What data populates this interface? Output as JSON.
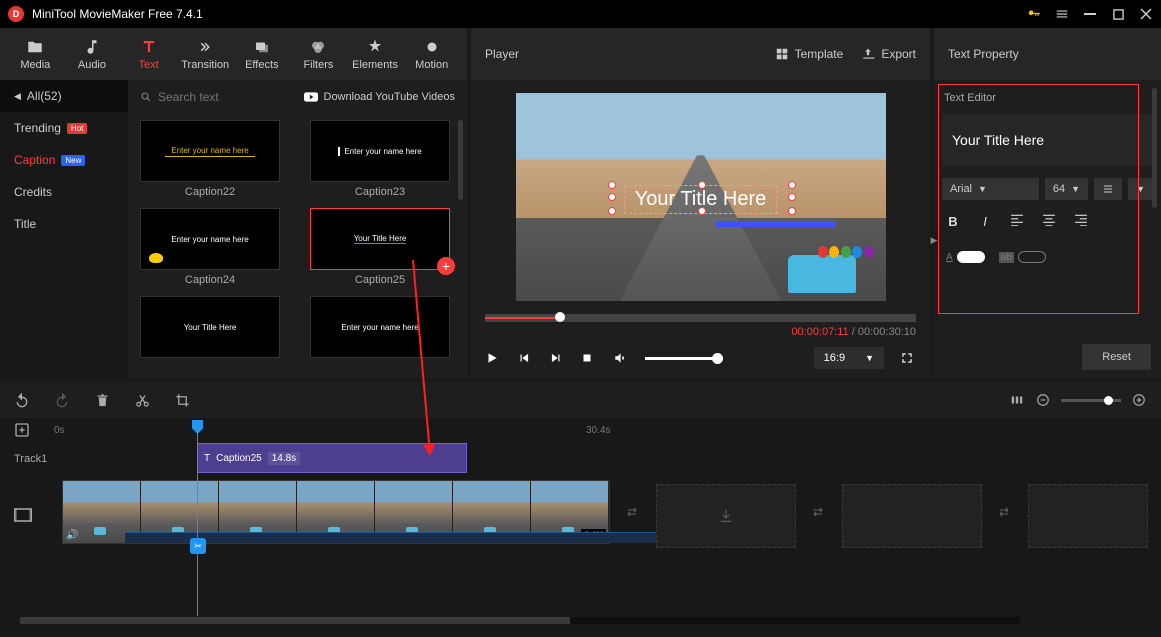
{
  "app": {
    "title": "MiniTool MovieMaker Free 7.4.1"
  },
  "toolTabs": [
    {
      "label": "Media",
      "icon": "folder"
    },
    {
      "label": "Audio",
      "icon": "music"
    },
    {
      "label": "Text",
      "icon": "text",
      "active": true
    },
    {
      "label": "Transition",
      "icon": "swap"
    },
    {
      "label": "Effects",
      "icon": "layers"
    },
    {
      "label": "Filters",
      "icon": "circle"
    },
    {
      "label": "Elements",
      "icon": "sparkle"
    },
    {
      "label": "Motion",
      "icon": "dot"
    }
  ],
  "sidebar": {
    "header": "All(52)",
    "items": [
      {
        "label": "Trending",
        "badge": "Hot",
        "badgeType": "hot"
      },
      {
        "label": "Caption",
        "badge": "New",
        "badgeType": "new",
        "active": true
      },
      {
        "label": "Credits"
      },
      {
        "label": "Title"
      }
    ]
  },
  "thumbs": {
    "searchPlaceholder": "Search text",
    "downloadLabel": "Download YouTube Videos",
    "items": [
      {
        "label": "Caption22",
        "text": "Enter your name here"
      },
      {
        "label": "Caption23",
        "text": "Enter your name here"
      },
      {
        "label": "Caption24",
        "text": "Enter your name here"
      },
      {
        "label": "Caption25",
        "text": "Your Title Here",
        "selected": true,
        "showAdd": true
      },
      {
        "label": "",
        "text": "Your Title Here"
      },
      {
        "label": "",
        "text": "Enter your name here"
      }
    ]
  },
  "player": {
    "title": "Player",
    "templateLabel": "Template",
    "exportLabel": "Export",
    "overlayText": "Your Title Here",
    "currentTime": "00:00:07:11",
    "totalTime": "00:00:30:10",
    "aspectRatio": "16:9"
  },
  "textProperty": {
    "panelTitle": "Text Property",
    "editorTitle": "Text Editor",
    "previewText": "Your Title Here",
    "font": "Arial",
    "size": "64",
    "resetLabel": "Reset"
  },
  "timeline": {
    "time0": "0s",
    "time30": "30.4s",
    "track1Label": "Track1",
    "clip": {
      "name": "Caption25",
      "duration": "14.8s"
    },
    "videoSpeed": "0.1X"
  }
}
